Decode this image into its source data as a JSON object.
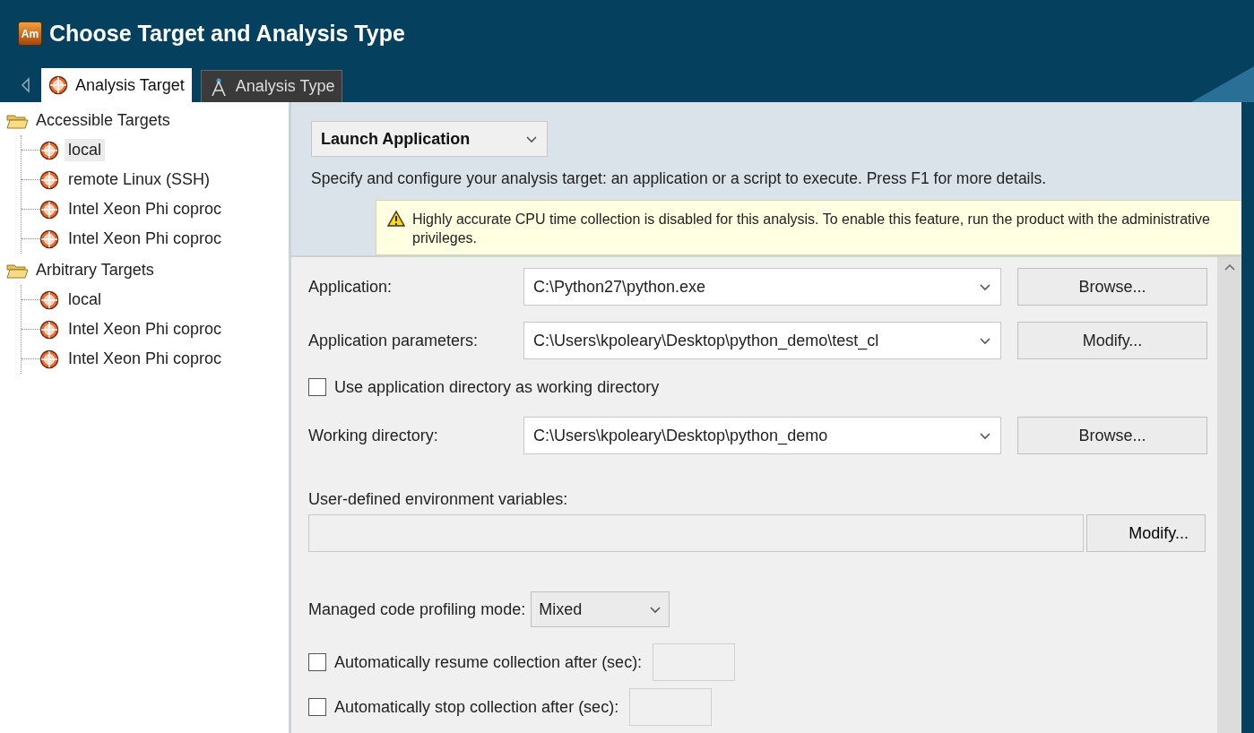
{
  "window": {
    "logo": "Am",
    "title": "Choose Target and Analysis Type"
  },
  "tabs": [
    {
      "label": "Analysis Target",
      "selected": true,
      "kind": "target"
    },
    {
      "label": "Analysis Type",
      "selected": false,
      "kind": "type"
    }
  ],
  "tree": [
    {
      "label": "Accessible Targets",
      "expanded": true,
      "children": [
        {
          "label": "local",
          "selected": true
        },
        {
          "label": "remote Linux (SSH)",
          "selected": false
        },
        {
          "label": "Intel Xeon Phi coproc",
          "selected": false
        },
        {
          "label": "Intel Xeon Phi coproc",
          "selected": false
        }
      ]
    },
    {
      "label": "Arbitrary Targets",
      "expanded": true,
      "children": [
        {
          "label": "local",
          "selected": false
        },
        {
          "label": "Intel Xeon Phi coproc",
          "selected": false
        },
        {
          "label": "Intel Xeon Phi coproc",
          "selected": false
        }
      ]
    }
  ],
  "launch_mode": {
    "value": "Launch Application"
  },
  "description": "Specify and configure your analysis target: an application or a script to execute. Press F1 for more details.",
  "warning": "Highly accurate CPU time collection is disabled for this analysis. To enable this feature, run the product with the administrative privileges.",
  "form": [
    {
      "kind": "combo",
      "label": "Application:",
      "value": "C:\\Python27\\python.exe",
      "button": "Browse..."
    },
    {
      "kind": "combo",
      "label": "Application parameters:",
      "value": "C:\\Users\\kpoleary\\Desktop\\python_demo\\test_cl",
      "button": "Modify..."
    },
    {
      "kind": "checkbox",
      "label": "Use application directory as working directory",
      "checked": false
    },
    {
      "kind": "combo",
      "label": "Working directory:",
      "value": "C:\\Users\\kpoleary\\Desktop\\python_demo",
      "button": "Browse..."
    },
    {
      "kind": "envvars",
      "label": "User-defined environment variables:",
      "button": "Modify..."
    },
    {
      "kind": "select",
      "label": "Managed code profiling mode:",
      "value": "Mixed"
    },
    {
      "kind": "checkbox-input",
      "label": "Automatically resume collection after (sec):",
      "checked": false
    },
    {
      "kind": "checkbox-input",
      "label": "Automatically stop collection after (sec):",
      "checked": false
    }
  ]
}
